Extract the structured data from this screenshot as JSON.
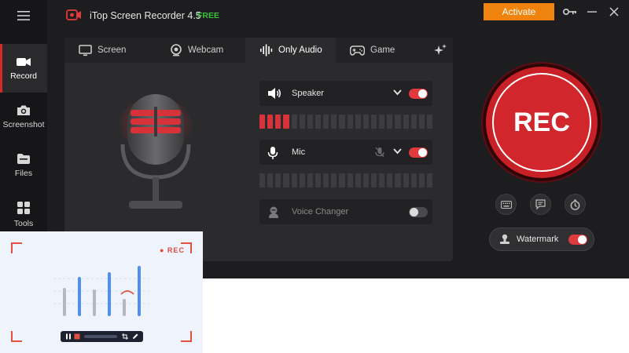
{
  "titlebar": {
    "app_title": "iTop Screen Recorder 4.5",
    "badge": "FREE",
    "activate_label": "Activate"
  },
  "sidebar": {
    "items": [
      {
        "label": "Record",
        "icon": "camera-record-icon",
        "active": true
      },
      {
        "label": "Screenshot",
        "icon": "camera-icon",
        "active": false
      },
      {
        "label": "Files",
        "icon": "folder-icon",
        "active": false
      },
      {
        "label": "Tools",
        "icon": "grid-icon",
        "active": false
      }
    ]
  },
  "tabs": [
    {
      "label": "Screen",
      "icon": "monitor-icon",
      "active": false
    },
    {
      "label": "Webcam",
      "icon": "webcam-icon",
      "active": false
    },
    {
      "label": "Only Audio",
      "icon": "waveform-icon",
      "active": true
    },
    {
      "label": "Game",
      "icon": "gamepad-icon",
      "active": false
    }
  ],
  "audio": {
    "speaker": {
      "label": "Speaker",
      "enabled": true,
      "level_segments_lit": 4,
      "level_segments_total": 22
    },
    "mic": {
      "label": "Mic",
      "enabled": true,
      "level_segments_lit": 0,
      "level_segments_total": 22
    },
    "voice_changer": {
      "label": "Voice Changer",
      "enabled": false
    }
  },
  "record": {
    "rec_label": "REC",
    "watermark_label": "Watermark",
    "watermark_enabled": true
  },
  "promo": {
    "rec_label": "● REC"
  },
  "colors": {
    "accent_red": "#d1262c",
    "activate_orange": "#f0830e",
    "free_green": "#3bc13b",
    "window_bg": "#1d1d1f"
  }
}
